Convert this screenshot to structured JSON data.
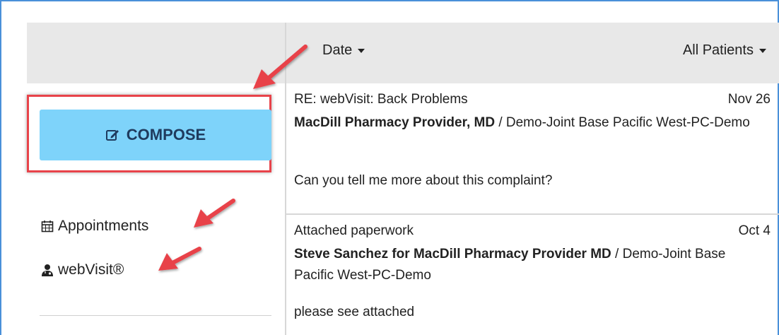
{
  "toolbar": {
    "sort_label": "Date",
    "filter_label": "All Patients"
  },
  "sidebar": {
    "compose_label": "COMPOSE",
    "compose_icon": "edit-icon",
    "items": [
      {
        "label": "Appointments",
        "icon": "calendar-icon"
      },
      {
        "label": "webVisit®",
        "icon": "doctor-icon"
      }
    ]
  },
  "messages": [
    {
      "subject": "RE: webVisit: Back Problems",
      "date": "Nov 26",
      "from_bold": "MacDill Pharmacy Provider, MD",
      "from_rest": " / Demo-Joint Base Pacific West-PC-Demo",
      "preview": "Can you tell me more about this complaint?"
    },
    {
      "subject": "Attached paperwork",
      "date": "Oct 4",
      "from_bold": "Steve Sanchez for MacDill Pharmacy Provider MD",
      "from_rest": " / Demo-Joint Base Pacific West-PC-Demo",
      "preview": "please see attached"
    }
  ],
  "colors": {
    "compose_bg": "#7ed3fa",
    "highlight": "#e8434a",
    "header_bg": "#e8e8e8",
    "frame": "#4a90d9"
  }
}
